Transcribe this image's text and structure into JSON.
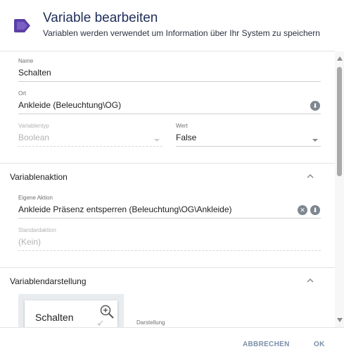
{
  "dialog": {
    "title": "Variable bearbeiten",
    "subtitle": "Variablen werden verwendet um Information über Ihr System zu speichern",
    "accent_color": "#5b3fa5"
  },
  "fields": {
    "name": {
      "label": "Name",
      "value": "Schalten"
    },
    "location": {
      "label": "Ort",
      "value": "Ankleide (Beleuchtung\\OG)",
      "icon": "info-icon"
    },
    "variable_type": {
      "label": "Variablentyp",
      "value": "Boolean",
      "disabled": true
    },
    "value": {
      "label": "Wert",
      "value": "False"
    }
  },
  "sections": {
    "action": {
      "title": "Variablenaktion",
      "custom_action": {
        "label": "Eigene Aktion",
        "value": "Ankleide Präsenz entsperren (Beleuchtung\\OG\\Ankleide)"
      },
      "default_action": {
        "label": "Standardaktion",
        "value": "(Kein)",
        "disabled": true
      }
    },
    "display": {
      "title": "Variablendarstellung",
      "preview_text": "Schalten",
      "representation_label": "Darstellung"
    }
  },
  "footer": {
    "cancel_label": "ABBRECHEN",
    "ok_label": "OK"
  }
}
